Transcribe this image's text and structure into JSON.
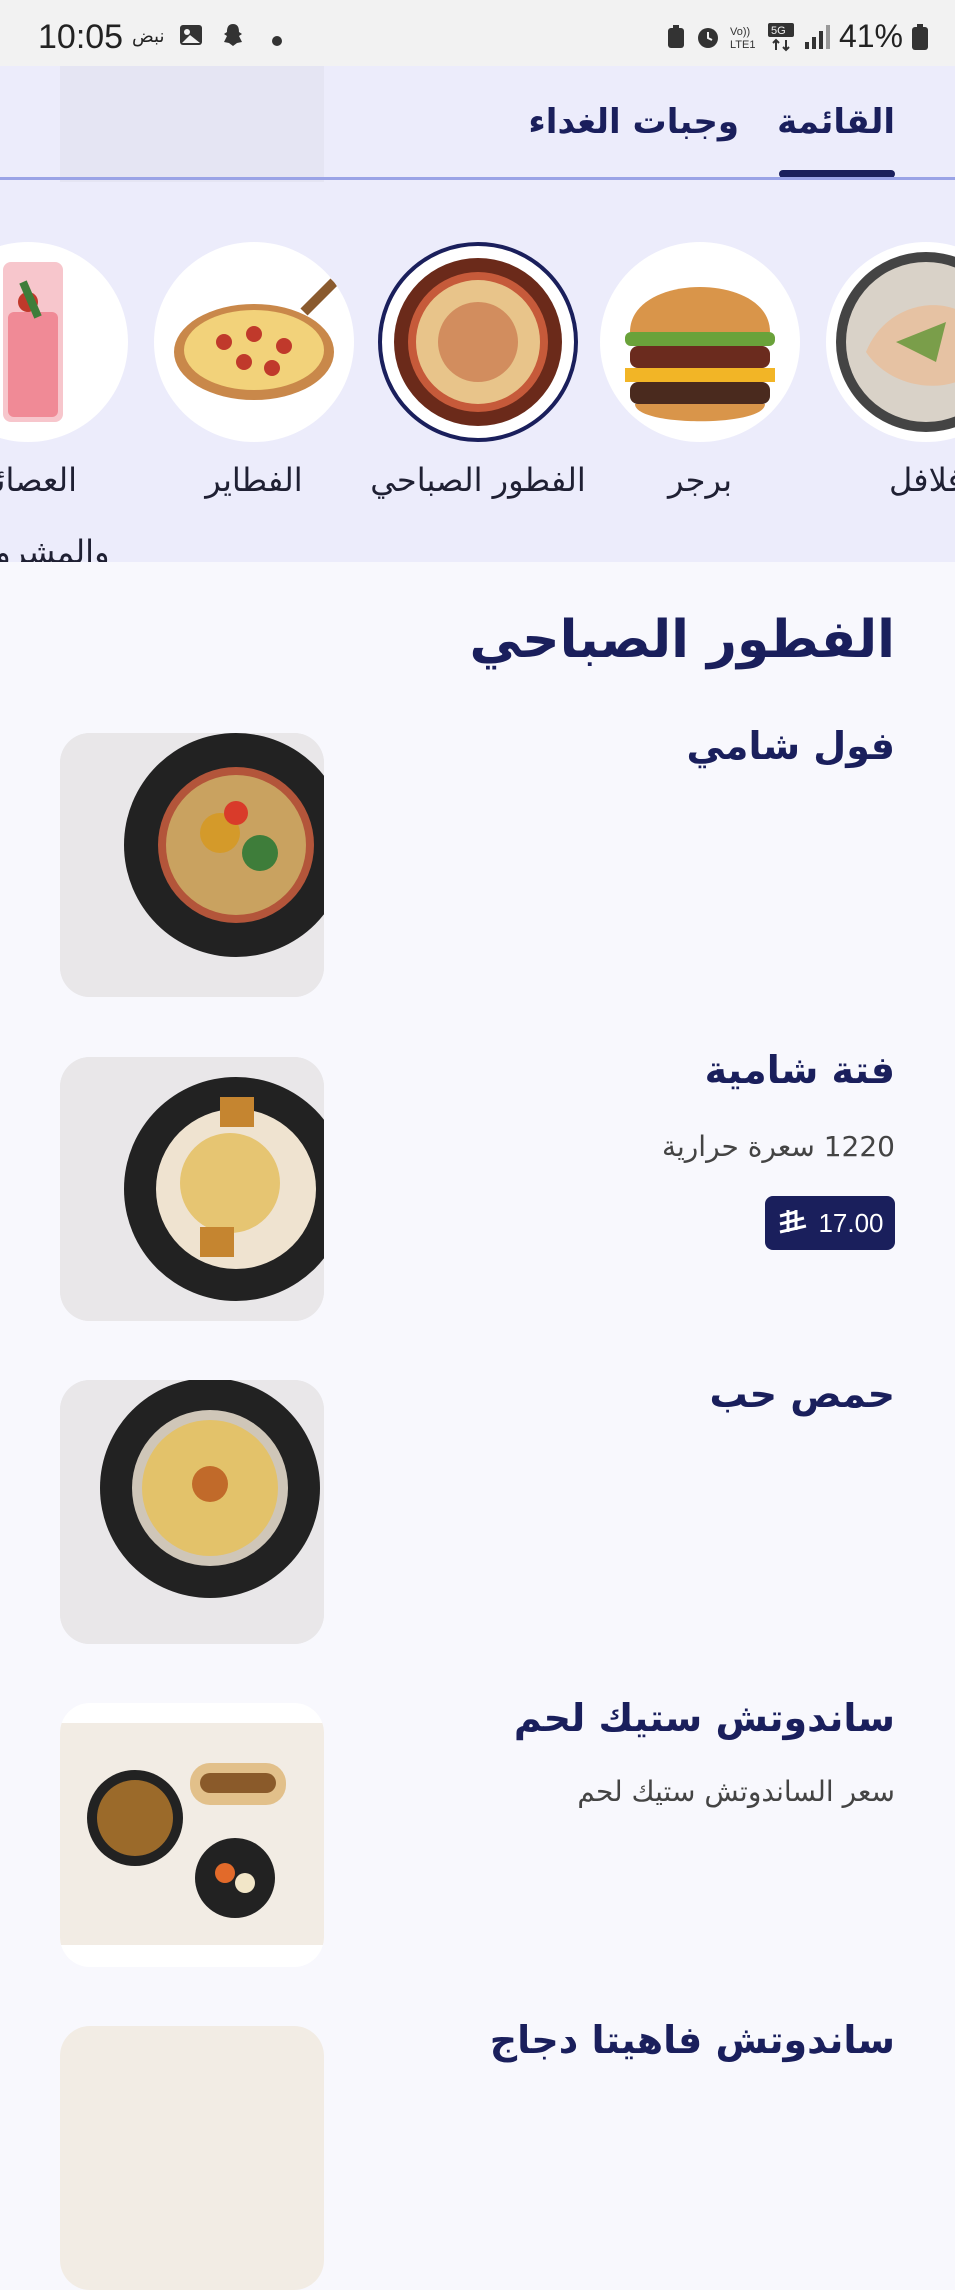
{
  "status": {
    "time": "10:05",
    "pulse": "نبض",
    "battery": "41%"
  },
  "tabs": {
    "menu": "القائمة",
    "lunch": "وجبات الغداء"
  },
  "categories": [
    {
      "label": "فلافل"
    },
    {
      "label": "برجر"
    },
    {
      "label": "الفطور الصباحي"
    },
    {
      "label": "الفطاير"
    },
    {
      "label": "العصائر والمشروبات"
    }
  ],
  "section": {
    "title": "الفطور الصباحي"
  },
  "items": [
    {
      "name": "فول شامي"
    },
    {
      "name": "فتة شامية",
      "desc": "1220 سعرة حرارية",
      "price": "17.00"
    },
    {
      "name": "حمص حب"
    },
    {
      "name": "ساندوتش ستيك لحم",
      "desc": "سعر الساندوتش ستيك لحم"
    },
    {
      "name": "ساندوتش فاهيتا دجاج"
    }
  ]
}
